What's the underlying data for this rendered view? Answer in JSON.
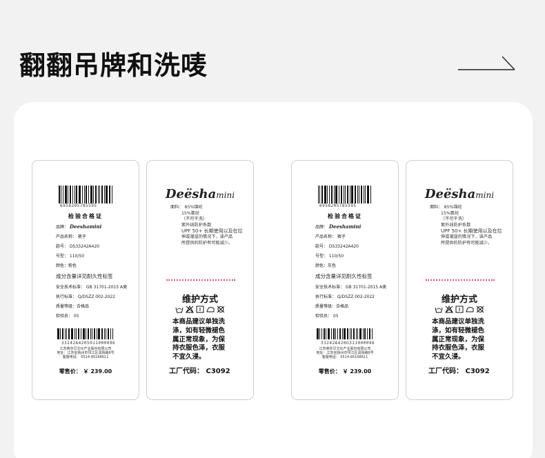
{
  "heading": "翻翻吊牌和洗唛",
  "tags": [
    {
      "barcode_top": "6958205785595",
      "cert_title": "检验合格证",
      "brand_label": "品牌：",
      "brand": "Deeshamini",
      "product": "产品名称： 裤子",
      "style_no": "款号： DS33242A420",
      "size": "号型： 110/50",
      "color": "颜色：粉色",
      "composition_note": "成分含量详见耐久性标签",
      "safety": "安全技术标准： GB 31701-2015 A类",
      "standard": "执行标准： Q/DSZZ 002-2022",
      "grade": "质量等级：合格品",
      "inspector": "检验员： 05",
      "barcode_bottom": "33242A4205911000096",
      "maker_1": "江苏英莎贝文化产业股份有限公司",
      "maker_2": "地址：江苏省扬州市邗江区润扬路8号",
      "maker_3": "客服电话： 0514-85168611",
      "price": "零售价： ￥   239.00"
    },
    {
      "barcode_top": "6958205785595",
      "cert_title": "检验合格证",
      "brand_label": "品牌：",
      "brand": "Deeshamini",
      "product": "产品名称： 裤子",
      "style_no": "款号： DS33242A420",
      "size": "号型： 110/50",
      "color": "颜色：灰色",
      "composition_note": "成分含量详见耐久性标签",
      "safety": "安全技术标准： GB 31701-2015 A类",
      "standard": "执行标准： Q/DSZZ 002-2022",
      "grade": "质量等级：合格品",
      "inspector": "检验员： 05",
      "barcode_bottom": "33242A420G311000096",
      "maker_1": "江苏英莎贝文化产业股份有限公司",
      "maker_2": "地址：江苏省扬州市邗江区润扬路8号",
      "maker_3": "客服电话： 0514-85168611",
      "price": "零售价： ￥   239.00"
    }
  ],
  "care": {
    "logo_main": "Deësha",
    "logo_sub": "mini",
    "comp_1": "面料： 85%锦纶",
    "comp_2": "15%氨纶",
    "comp_3": "（不可干洗）",
    "comp_4": "紫外线防护系数",
    "comp_5": "UPF 50+ 长期使用以及在拉",
    "comp_6": "伸或潮湿的情况下，该产品",
    "comp_7": "所提供的防护有可能减少。",
    "title": "维护方式",
    "text_1": "本商品建议单独洗",
    "text_2": "涤，如有轻微褪色",
    "text_3": "属正常现象，为保",
    "text_4": "持衣服色泽，衣服",
    "text_5": "不宜久浸。",
    "factory": "工厂代码： C3092",
    "symbol_icons": [
      "hand-wash-icon",
      "no-bleach-icon",
      "tumble-dry-icon",
      "iron-low-icon",
      "no-dry-clean-icon"
    ]
  },
  "colors": {
    "panel": "#ffffff",
    "background": "#f2f2f2",
    "dots": "#e0468a"
  }
}
